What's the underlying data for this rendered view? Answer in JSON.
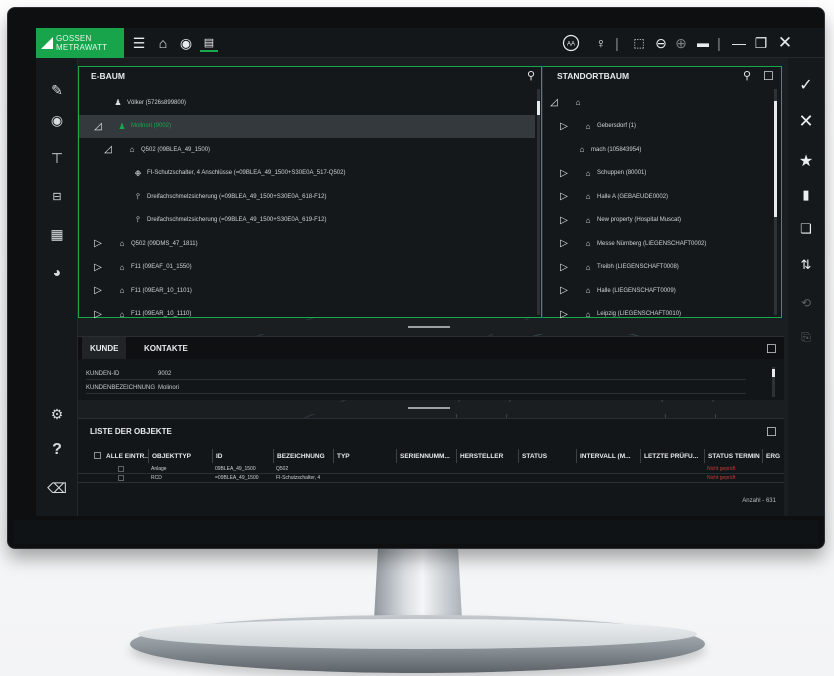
{
  "app": {
    "brand": "GOSSEN METRAWATT"
  },
  "ebaum": {
    "title": "E-BAUM",
    "rows": [
      {
        "label": "Völker (5726s899800)",
        "expander": "",
        "icon": "person-icon",
        "level": 1,
        "selected": false
      },
      {
        "label": "Molinori (9002)",
        "expander": "◿",
        "icon": "person-icon",
        "level": 0,
        "selected": true
      },
      {
        "label": "Q502 (09BLEA_49_1500)",
        "expander": "◿",
        "icon": "building-icon",
        "level": 1,
        "selected": false
      },
      {
        "label": "FI-Schutzschalter, 4 Anschlüsse (=09BLEA_49_1500+S30E0A_517-Q502)",
        "expander": "",
        "icon": "device-icon",
        "level": 2,
        "selected": false
      },
      {
        "label": "Dreifachschmelzsicherung (=09BLEA_49_1500+S30E0A_618-F12)",
        "expander": "",
        "icon": "fuse-icon",
        "level": 2,
        "selected": false
      },
      {
        "label": "Dreifachschmelzsicherung (=09BLEA_49_1500+S30E0A_619-F12)",
        "expander": "",
        "icon": "fuse-icon",
        "level": 2,
        "selected": false
      },
      {
        "label": "Q502 (09DMS_47_1811)",
        "expander": "▷",
        "icon": "building-icon",
        "level": 0,
        "selected": false
      },
      {
        "label": "F11 (09EAF_01_1550)",
        "expander": "▷",
        "icon": "building-icon",
        "level": 0,
        "selected": false
      },
      {
        "label": "F11 (09EAR_10_1101)",
        "expander": "▷",
        "icon": "building-icon",
        "level": 0,
        "selected": false
      },
      {
        "label": "F11 (09EAR_10_1110)",
        "expander": "▷",
        "icon": "building-icon",
        "level": 0,
        "selected": false
      }
    ]
  },
  "standortbaum": {
    "title": "STANDORTBAUM",
    "rows": [
      {
        "label": "",
        "expander": "◿",
        "icon": "building-icon",
        "level": 0
      },
      {
        "label": "Gebersdorf (1)",
        "expander": "▷",
        "icon": "building-icon",
        "level": 1
      },
      {
        "label": "mach (105843954)",
        "expander": "",
        "icon": "building-icon",
        "level": 1
      },
      {
        "label": "Schuppen (80001)",
        "expander": "▷",
        "icon": "house-icon",
        "level": 1
      },
      {
        "label": "Halle A (GEBAEUDE0002)",
        "expander": "▷",
        "icon": "house-icon",
        "level": 1
      },
      {
        "label": "New property (Hospital Muscat)",
        "expander": "▷",
        "icon": "building-icon",
        "level": 1
      },
      {
        "label": "Messe Nürnberg (LIEGENSCHAFT0002)",
        "expander": "▷",
        "icon": "building-icon",
        "level": 1
      },
      {
        "label": "Treibh (LIEGENSCHAFT0008)",
        "expander": "▷",
        "icon": "building-icon",
        "level": 1
      },
      {
        "label": "Halle (LIEGENSCHAFT0009)",
        "expander": "▷",
        "icon": "building-icon",
        "level": 1
      },
      {
        "label": "Leipzig (LIEGENSCHAFT0010)",
        "expander": "▷",
        "icon": "building-icon",
        "level": 1
      }
    ]
  },
  "kunde": {
    "tabs": [
      "KUNDE",
      "KONTAKTE"
    ],
    "fields": [
      {
        "label": "KUNDEN-ID",
        "value": "9002"
      },
      {
        "label": "KUNDENBEZEICHNUNG",
        "value": "Molinori"
      }
    ]
  },
  "liste": {
    "title": "LISTE DER OBJEKTE",
    "columns": [
      "ALLE EINTR...",
      "OBJEKTTYP",
      "ID",
      "BEZEICHNUNG",
      "TYP",
      "SERIENNUMM...",
      "HERSTELLER",
      "STATUS",
      "INTERVALL (M...",
      "LETZTE PRÜFU...",
      "STATUS TERMIN",
      "ERG"
    ],
    "rows": [
      {
        "objekttyp": "Anlage",
        "id": "09BLEA_49_1500",
        "bezeichnung": "Q502",
        "status_termin": "Nicht geprüft"
      },
      {
        "objekttyp": "RCD",
        "id": "=09BLEA_49_1500",
        "bezeichnung": "FI-Schutzschalter, 4",
        "status_termin": "Nicht geprüft"
      }
    ],
    "count": "Anzahl - 631"
  },
  "colors": {
    "accent": "#19a84b",
    "background": "#1b1e21",
    "error": "#c53a3a"
  }
}
